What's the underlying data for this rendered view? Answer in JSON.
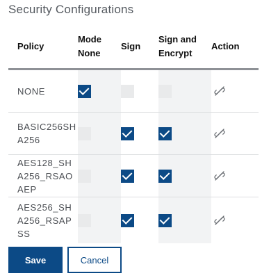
{
  "title": "Security Configurations",
  "columns": {
    "policy": "Policy",
    "mode_none": "Mode None",
    "sign": "Sign",
    "sign_and_encrypt": "Sign and Encrypt",
    "action": "Action"
  },
  "rows": [
    {
      "policy": "NONE",
      "mode_none": true,
      "sign": false,
      "sign_and_encrypt": false,
      "action_icon": "link-broken-icon"
    },
    {
      "policy": "BASIC256SHA256",
      "mode_none": false,
      "sign": true,
      "sign_and_encrypt": true,
      "action_icon": "link-broken-icon"
    },
    {
      "policy": "AES128_SHA256_RSAOAEP",
      "mode_none": false,
      "sign": true,
      "sign_and_encrypt": true,
      "action_icon": "link-broken-icon"
    },
    {
      "policy": "AES256_SHA256_RSAPSS",
      "mode_none": false,
      "sign": true,
      "sign_and_encrypt": true,
      "action_icon": "link-broken-icon"
    }
  ],
  "buttons": {
    "save": "Save",
    "cancel": "Cancel"
  },
  "colors": {
    "accent": "#0c4a86",
    "checkbox_disabled": "#e9eaeb",
    "column_shade": "#f2f3f4"
  }
}
